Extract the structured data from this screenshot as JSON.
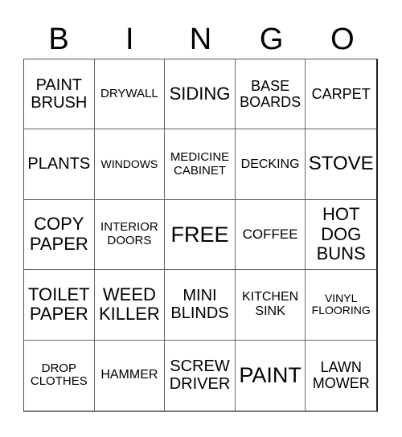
{
  "header": {
    "letters": [
      "B",
      "I",
      "N",
      "G",
      "O"
    ]
  },
  "cells": [
    "PAINT BRUSH",
    "DRYWALL",
    "SIDING",
    "BASE BOARDS",
    "CARPET",
    "PLANTS",
    "WINDOWS",
    "MEDICINE CABINET",
    "DECKING",
    "STOVE",
    "COPY PAPER",
    "INTERIOR DOORS",
    "FREE",
    "COFFEE",
    "HOT DOG BUNS",
    "TOILET PAPER",
    "WEED KILLER",
    "MINI BLINDS",
    "KITCHEN SINK",
    "VINYL FLOORING",
    "DROP CLOTHES",
    "HAMMER",
    "SCREW DRIVER",
    "PAINT",
    "LAWN MOWER"
  ]
}
